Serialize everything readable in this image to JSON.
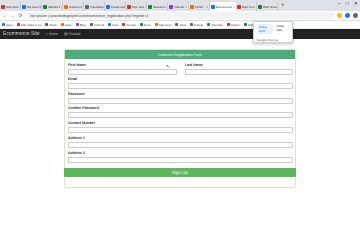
{
  "browser": {
    "tabs": [
      {
        "label": "Ship Also",
        "color": "#d93025"
      },
      {
        "label": "We How To",
        "color": "#1a73e8"
      },
      {
        "label": "SELEN 1",
        "color": "#188038"
      },
      {
        "label": "Autoscrol",
        "color": "#e37400"
      },
      {
        "label": "Tutorialspt",
        "color": "#5f6368"
      },
      {
        "label": "Postal code",
        "color": "#1a73e8"
      },
      {
        "label": "SQL Test",
        "color": "#d93025"
      },
      {
        "label": "Selenium",
        "color": "#188038"
      },
      {
        "label": "Tutorial",
        "color": "#9334e6"
      },
      {
        "label": "XPath",
        "color": "#e37400"
      },
      {
        "label": "Ecommerce",
        "color": "#1a73e8",
        "active": true
      },
      {
        "label": "Web Tour",
        "color": "#d93025"
      },
      {
        "label": "Web Driver",
        "color": "#188038"
      }
    ],
    "new_tab": "+",
    "window_controls": [
      "–",
      "□",
      "✕"
    ],
    "nav": {
      "back": "←",
      "forward": "→",
      "reload": "⟳"
    },
    "url": "Not secure | www.testingexpert.com/ecommerce_registration.php?register=1"
  },
  "bookmarks": [
    "Apps",
    "SQL Data & Co",
    "Stack",
    "Apps",
    "Blog",
    "Android",
    "Auto",
    "Google",
    "Docs",
    "Selenium",
    "Java",
    "Testing",
    "Tutorials",
    "Python",
    "SQL",
    "Code",
    "More"
  ],
  "site": {
    "brand": "Ecommerce Site",
    "links": [
      {
        "icon": "home-icon",
        "label": "Home"
      },
      {
        "icon": "cart-icon",
        "label": "Product"
      }
    ]
  },
  "popup": {
    "chip1": "Chilig April",
    "chip2": "Chilig Sale",
    "line2": "Google Chrome"
  },
  "form": {
    "title": "Customer Registration Form",
    "first_name": "First Name",
    "last_name": "Last Name",
    "email": "Email",
    "password": "Password",
    "confirm_password": "Confirm Password",
    "contact_number": "Contact Number",
    "address1": "Address 1",
    "address2": "Address 2",
    "submit": "Sign Up"
  },
  "colors": {
    "header_green": "#4cae7c",
    "button_green": "#5cb85c",
    "navbar": "#222222"
  }
}
